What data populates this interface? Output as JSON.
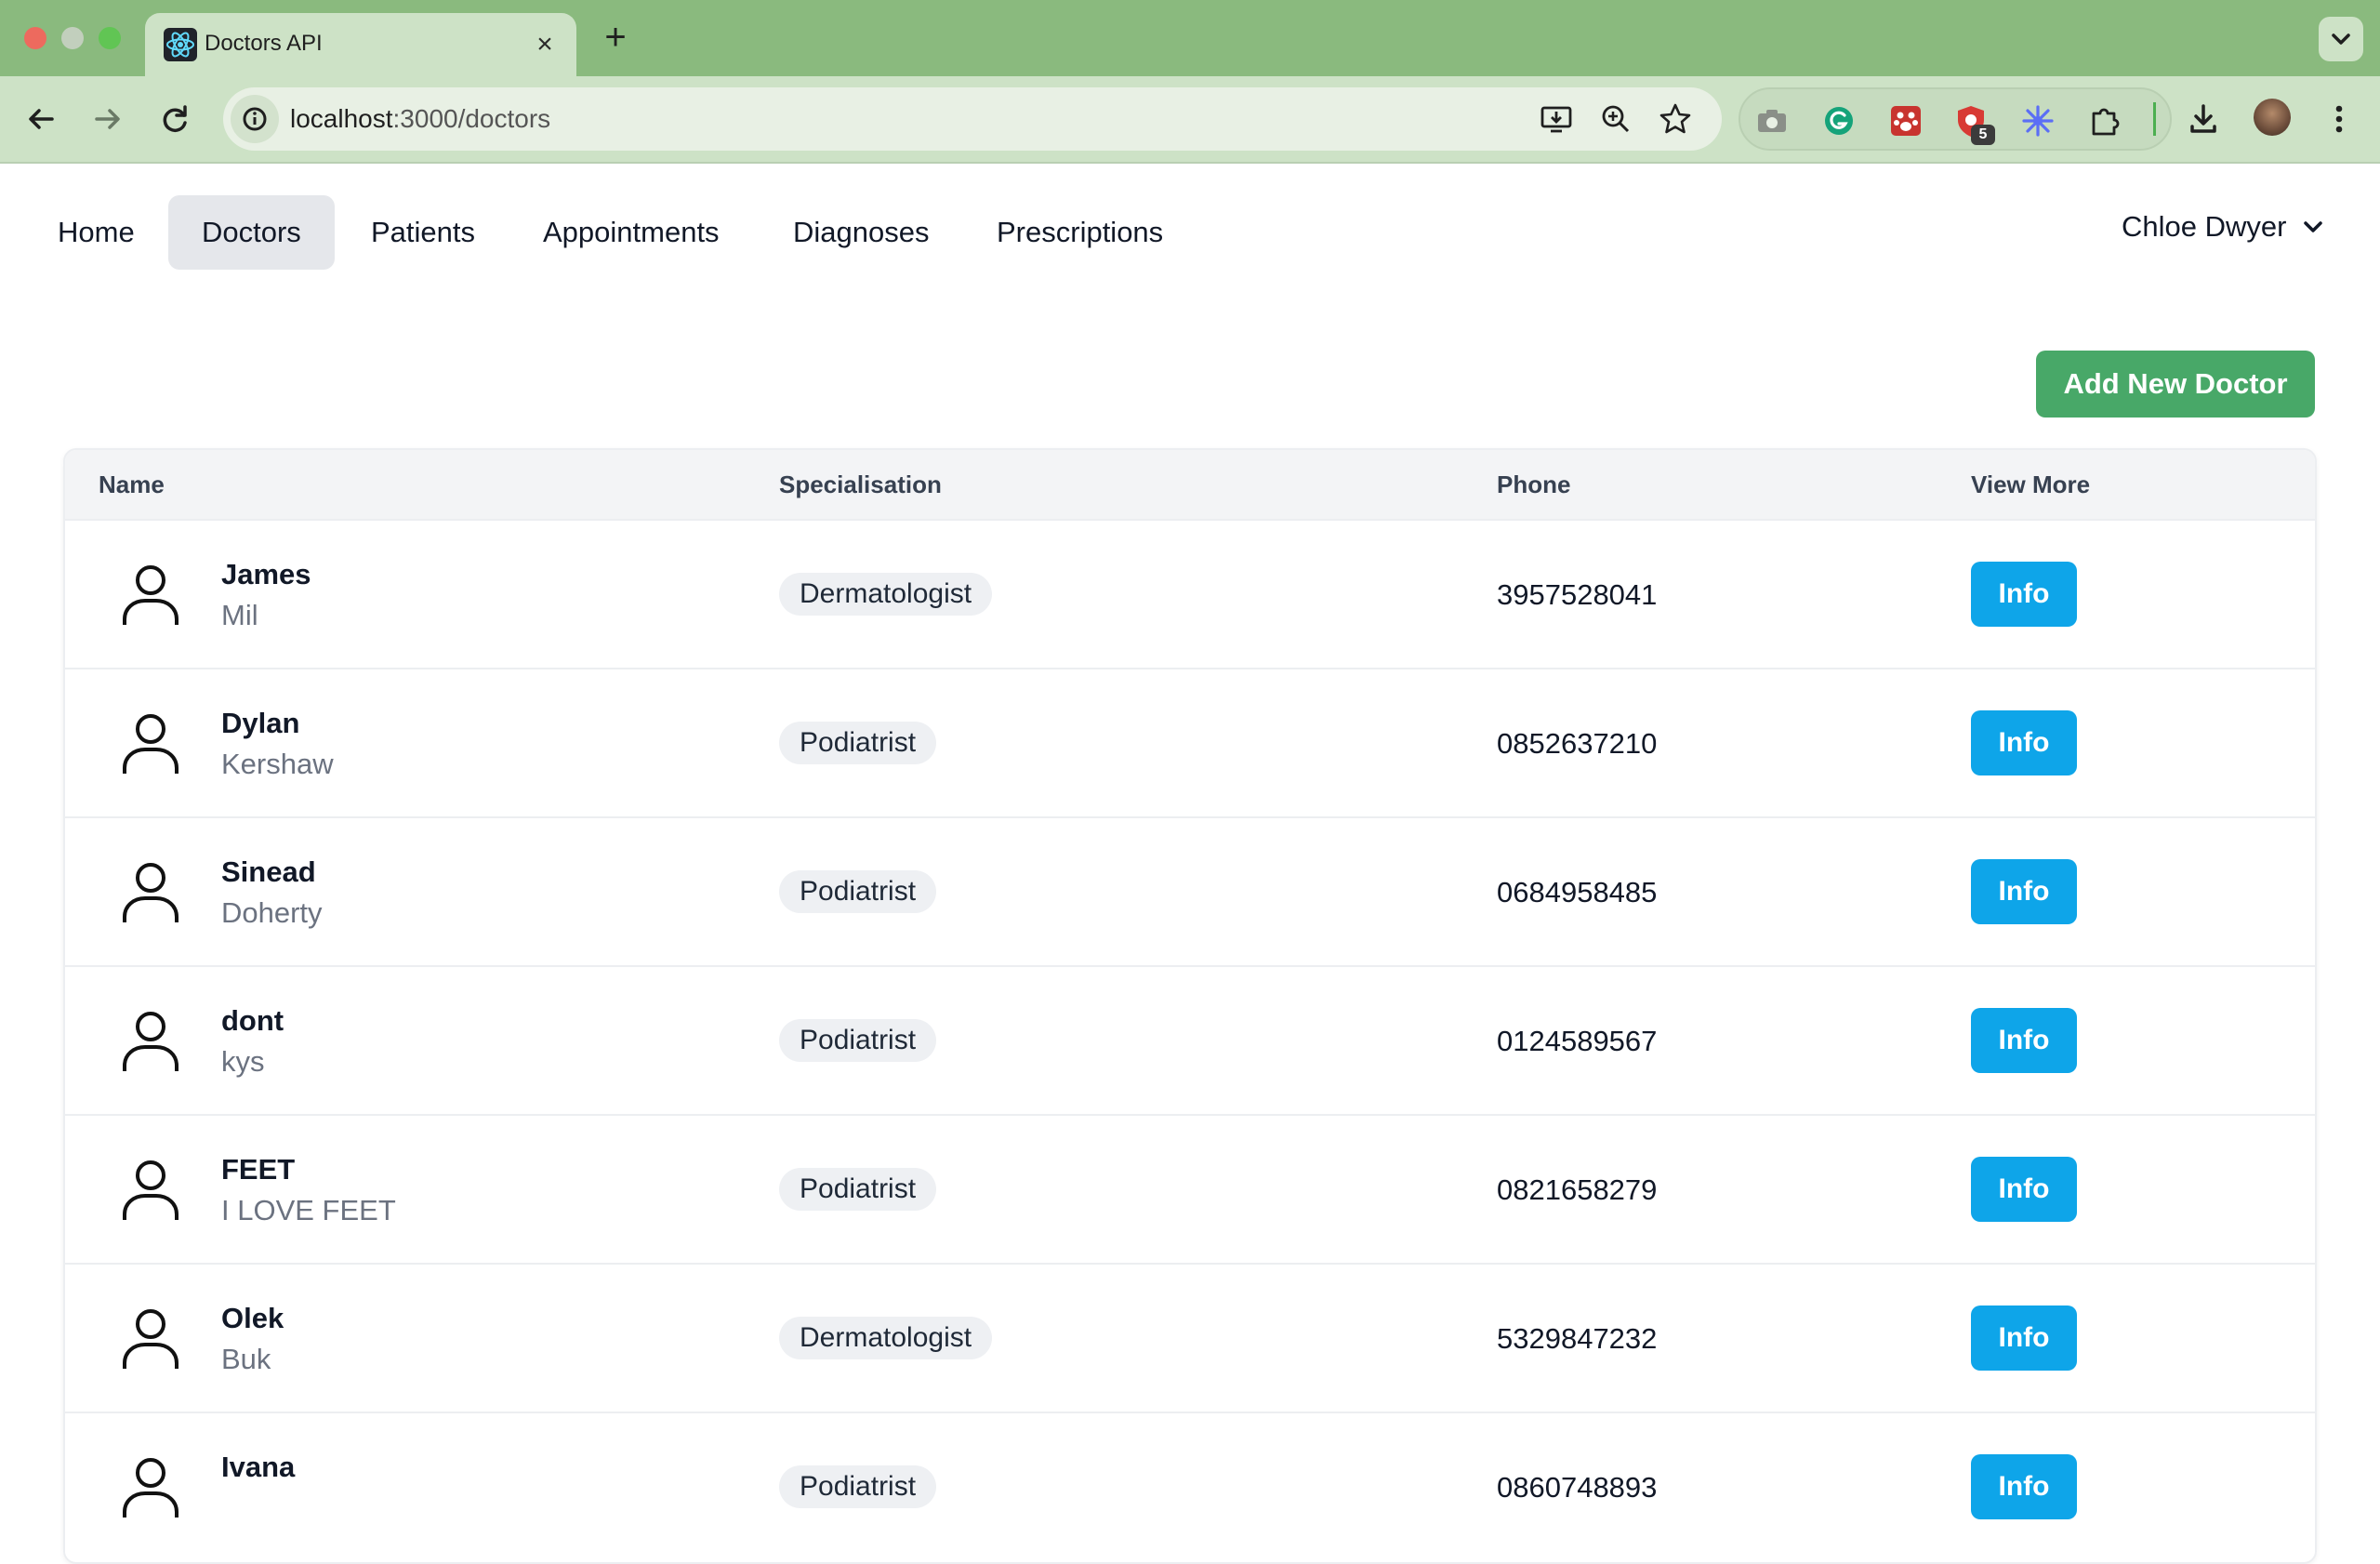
{
  "browser": {
    "tab_title": "Doctors API",
    "url_host": "localhost",
    "url_path": ":3000/doctors",
    "extension_badge": "5"
  },
  "nav": {
    "links": [
      "Home",
      "Doctors",
      "Patients",
      "Appointments",
      "Diagnoses",
      "Prescriptions"
    ],
    "active": "Doctors",
    "user_name": "Chloe Dwyer"
  },
  "page": {
    "add_button": "Add New Doctor"
  },
  "table": {
    "headers": [
      "Name",
      "Specialisation",
      "Phone",
      "View More"
    ],
    "rows": [
      {
        "first": "James",
        "last": "Mil",
        "specialisation": "Dermatologist",
        "phone": "3957528041",
        "action": "Info"
      },
      {
        "first": "Dylan",
        "last": "Kershaw",
        "specialisation": "Podiatrist",
        "phone": "0852637210",
        "action": "Info"
      },
      {
        "first": "Sinead",
        "last": "Doherty",
        "specialisation": "Podiatrist",
        "phone": "0684958485",
        "action": "Info"
      },
      {
        "first": "dont",
        "last": "kys",
        "specialisation": "Podiatrist",
        "phone": "0124589567",
        "action": "Info"
      },
      {
        "first": "FEET",
        "last": "I LOVE FEET",
        "specialisation": "Podiatrist",
        "phone": "0821658279",
        "action": "Info"
      },
      {
        "first": "Olek",
        "last": "Buk",
        "specialisation": "Dermatologist",
        "phone": "5329847232",
        "action": "Info"
      },
      {
        "first": "Ivana",
        "last": "",
        "specialisation": "Podiatrist",
        "phone": "0860748893",
        "action": "Info"
      }
    ]
  },
  "colors": {
    "chrome_tabbar": "#8aba7e",
    "chrome_toolbar": "#cde2c6",
    "add_button": "#48a868",
    "info_button": "#0ea5e9"
  }
}
